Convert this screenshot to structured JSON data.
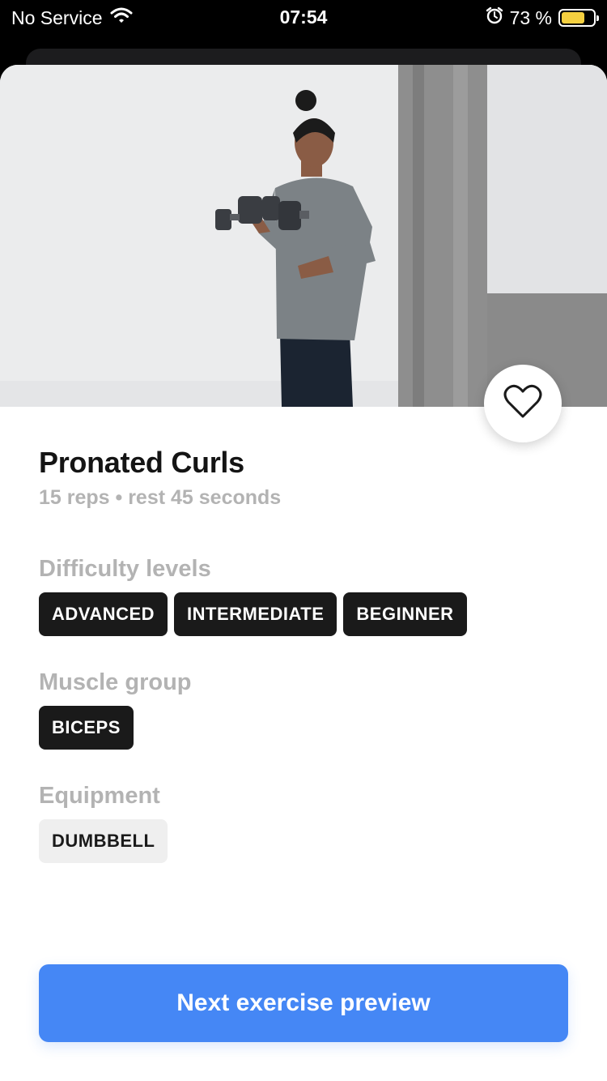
{
  "status_bar": {
    "carrier": "No Service",
    "time": "07:54",
    "battery_percent": "73 %",
    "battery_level": 0.73,
    "battery_color": "#f5d040",
    "icons": [
      "wifi-icon",
      "alarm-icon",
      "battery-icon"
    ]
  },
  "exercise": {
    "title": "Pronated Curls",
    "subtitle": "15 reps • rest 45 seconds",
    "favorite_icon": "heart-outline-icon"
  },
  "difficulty": {
    "label": "Difficulty levels",
    "chips": [
      "ADVANCED",
      "INTERMEDIATE",
      "BEGINNER"
    ]
  },
  "muscle_group": {
    "label": "Muscle group",
    "chips": [
      "BICEPS"
    ]
  },
  "equipment": {
    "label": "Equipment",
    "chips": [
      "DUMBBELL"
    ]
  },
  "actions": {
    "next_label": "Next exercise preview",
    "accent_color": "#4587f5"
  }
}
